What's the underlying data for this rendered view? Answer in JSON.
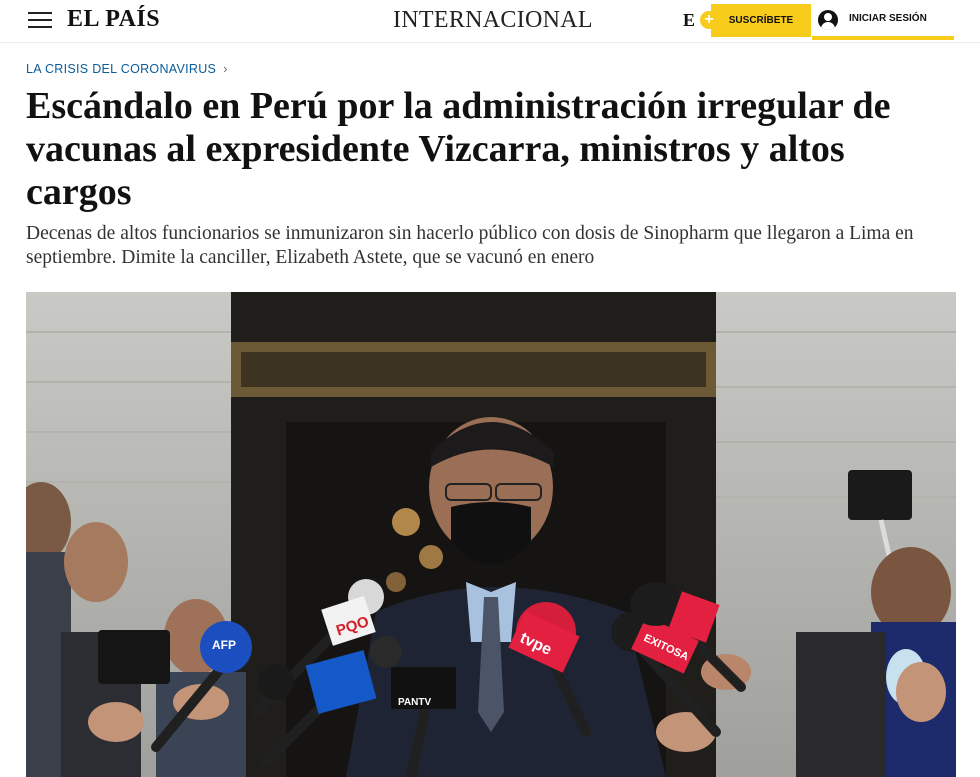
{
  "header": {
    "logo": "EL PAÍS",
    "section": "INTERNACIONAL",
    "e_badge": "E",
    "subscribe_label": "SUSCRÍBETE",
    "login_label": "INICIAR SESIÓN"
  },
  "article": {
    "kicker": "LA CRISIS DEL CORONAVIRUS",
    "headline": "Escándalo en Perú por la administración irregular de vacunas al expresidente Vizcarra, ministros y altos cargos",
    "standfirst": "Decenas de altos funcionarios se inmunizaron sin hacerlo público con dosis de Sinopharm que llegaron a Lima en septiembre. Dimite la canciller, Elizabeth Astete, que se vacunó en enero"
  },
  "photo": {
    "mic_labels": [
      "AFP",
      "PQO",
      "tvpe",
      "EXITOSA",
      "PANTV"
    ]
  },
  "icons": {
    "menu": "hamburger-menu-icon",
    "plus": "plus-circle-icon",
    "user": "user-avatar-icon",
    "chevron": "chevron-right-icon"
  },
  "colors": {
    "accent_yellow": "#f7cc1a",
    "kicker_blue": "#0b5c99"
  }
}
